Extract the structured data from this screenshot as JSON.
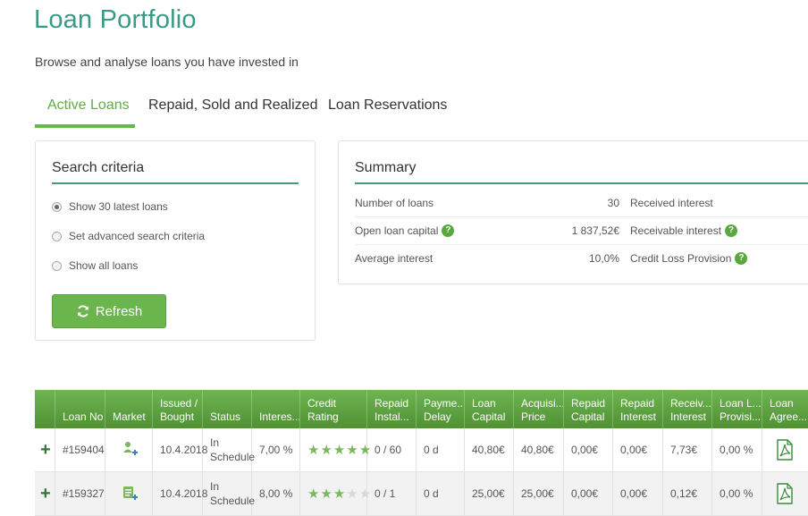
{
  "page": {
    "title": "Loan Portfolio",
    "subtitle": "Browse and analyse loans you have invested in"
  },
  "tabs": [
    {
      "label": "Active Loans",
      "active": true
    },
    {
      "label": "Repaid, Sold and Realized",
      "active": false
    },
    {
      "label": "Loan Reservations",
      "active": false
    }
  ],
  "search": {
    "title": "Search criteria",
    "options": [
      {
        "label": "Show 30 latest loans",
        "checked": true
      },
      {
        "label": "Set advanced search criteria",
        "checked": false
      },
      {
        "label": "Show all loans",
        "checked": false
      }
    ],
    "refresh_label": "Refresh"
  },
  "summary": {
    "title": "Summary",
    "rows": [
      {
        "label": "Number of loans",
        "value": "30",
        "right_label": "Received interest",
        "help": false,
        "right_help": false
      },
      {
        "label": "Open loan capital",
        "value": "1 837,52€",
        "right_label": "Receivable interest",
        "help": true,
        "right_help": true
      },
      {
        "label": "Average interest",
        "value": "10,0%",
        "right_label": "Credit Loss Provision",
        "help": false,
        "right_help": true
      }
    ]
  },
  "table": {
    "columns": [
      {
        "key": "loan_no",
        "lines": [
          "Loan No"
        ]
      },
      {
        "key": "market",
        "lines": [
          "Market"
        ]
      },
      {
        "key": "issued",
        "lines": [
          "Issued /",
          "Bought"
        ]
      },
      {
        "key": "status",
        "lines": [
          "Status"
        ]
      },
      {
        "key": "interest",
        "lines": [
          "Interes..."
        ]
      },
      {
        "key": "rating",
        "lines": [
          "Credit",
          "Rating"
        ]
      },
      {
        "key": "repaid_inst",
        "lines": [
          "Repaid",
          "Instal..."
        ]
      },
      {
        "key": "payment_delay",
        "lines": [
          "Payme...",
          "Delay"
        ]
      },
      {
        "key": "loan_capital",
        "lines": [
          "Loan",
          "Capital"
        ]
      },
      {
        "key": "acq_price",
        "lines": [
          "Acquisi...",
          "Price"
        ]
      },
      {
        "key": "repaid_capital",
        "lines": [
          "Repaid",
          "Capital"
        ]
      },
      {
        "key": "repaid_interest",
        "lines": [
          "Repaid",
          "Interest"
        ]
      },
      {
        "key": "receivable_interest",
        "lines": [
          "Receiv...",
          "Interest"
        ]
      },
      {
        "key": "loan_loss",
        "lines": [
          "Loan L...",
          "Provisi..."
        ]
      },
      {
        "key": "agreement",
        "lines": [
          "Loan",
          "Agree..."
        ]
      }
    ],
    "rows": [
      {
        "loan_no": "#159404",
        "market_icon": "user-plus-icon",
        "issued": "10.4.2018",
        "status": [
          "In",
          "Schedule"
        ],
        "interest": "7,00 %",
        "rating": 5,
        "repaid_inst": "0 / 60",
        "payment_delay": "0 d",
        "loan_capital": "40,80€",
        "acq_price": "40,80€",
        "repaid_capital": "0,00€",
        "repaid_interest": "0,00€",
        "receivable_interest": "7,73€",
        "loan_loss": "0,00 %",
        "agreement_icon": "pdf-icon"
      },
      {
        "loan_no": "#159327",
        "market_icon": "list-plus-icon",
        "issued": "10.4.2018",
        "status": [
          "In",
          "Schedule"
        ],
        "interest": "8,00 %",
        "rating": 3,
        "repaid_inst": "0 / 1",
        "payment_delay": "0 d",
        "loan_capital": "25,00€",
        "acq_price": "25,00€",
        "repaid_capital": "0,00€",
        "repaid_interest": "0,00€",
        "receivable_interest": "0,12€",
        "loan_loss": "0,00 %",
        "agreement_icon": "pdf-icon"
      }
    ]
  },
  "colors": {
    "title": "#3a9a86",
    "accent_green": "#6ab64d",
    "header_green": "#5aa03f",
    "teal_rule": "#3f9b86"
  }
}
